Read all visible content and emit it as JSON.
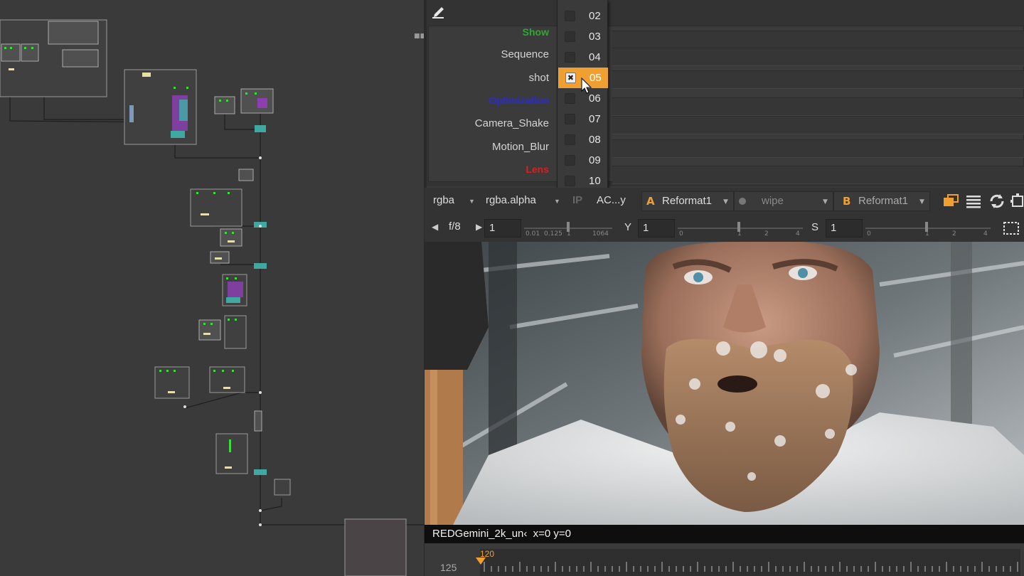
{
  "properties": {
    "knobs": [
      {
        "label": "Show",
        "type": "section",
        "color": "#2fa82f"
      },
      {
        "label": "Sequence",
        "type": "field"
      },
      {
        "label": "shot",
        "type": "field"
      },
      {
        "label": "Optimization",
        "type": "section",
        "color": "#2a2ad8"
      },
      {
        "label": "Camera_Shake",
        "type": "field"
      },
      {
        "label": "Motion_Blur",
        "type": "field"
      },
      {
        "label": "Lens",
        "type": "section",
        "color": "#d82020"
      }
    ],
    "shot_dropdown": {
      "items": [
        "02",
        "03",
        "04",
        "05",
        "06",
        "07",
        "08",
        "09",
        "10"
      ],
      "selected": "05",
      "accent": "#f0a030"
    }
  },
  "viewer": {
    "channels": "rgba",
    "alpha_channel": "rgba.alpha",
    "ip_label": "IP",
    "colorspace": "AC...y",
    "input_a_letter": "A",
    "input_a": "Reformat1",
    "wipe": "wipe",
    "input_b_letter": "B",
    "input_b": "Reformat1",
    "fstop": "f/8",
    "gain": "1",
    "gain_ticks": [
      "0.01",
      "0.125",
      "1",
      "1064"
    ],
    "gamma_label": "Y",
    "gamma": "1",
    "gamma_ticks": [
      "0",
      "1",
      "2",
      "4"
    ],
    "saturation_label": "S",
    "saturation": "1",
    "saturation_ticks": [
      "0",
      "1",
      "2",
      "4"
    ],
    "info_clip": "REDGemini_2k_un‹",
    "info_coords": "x=0 y=0"
  },
  "timeline": {
    "current_frame": "125",
    "marker": "120"
  }
}
